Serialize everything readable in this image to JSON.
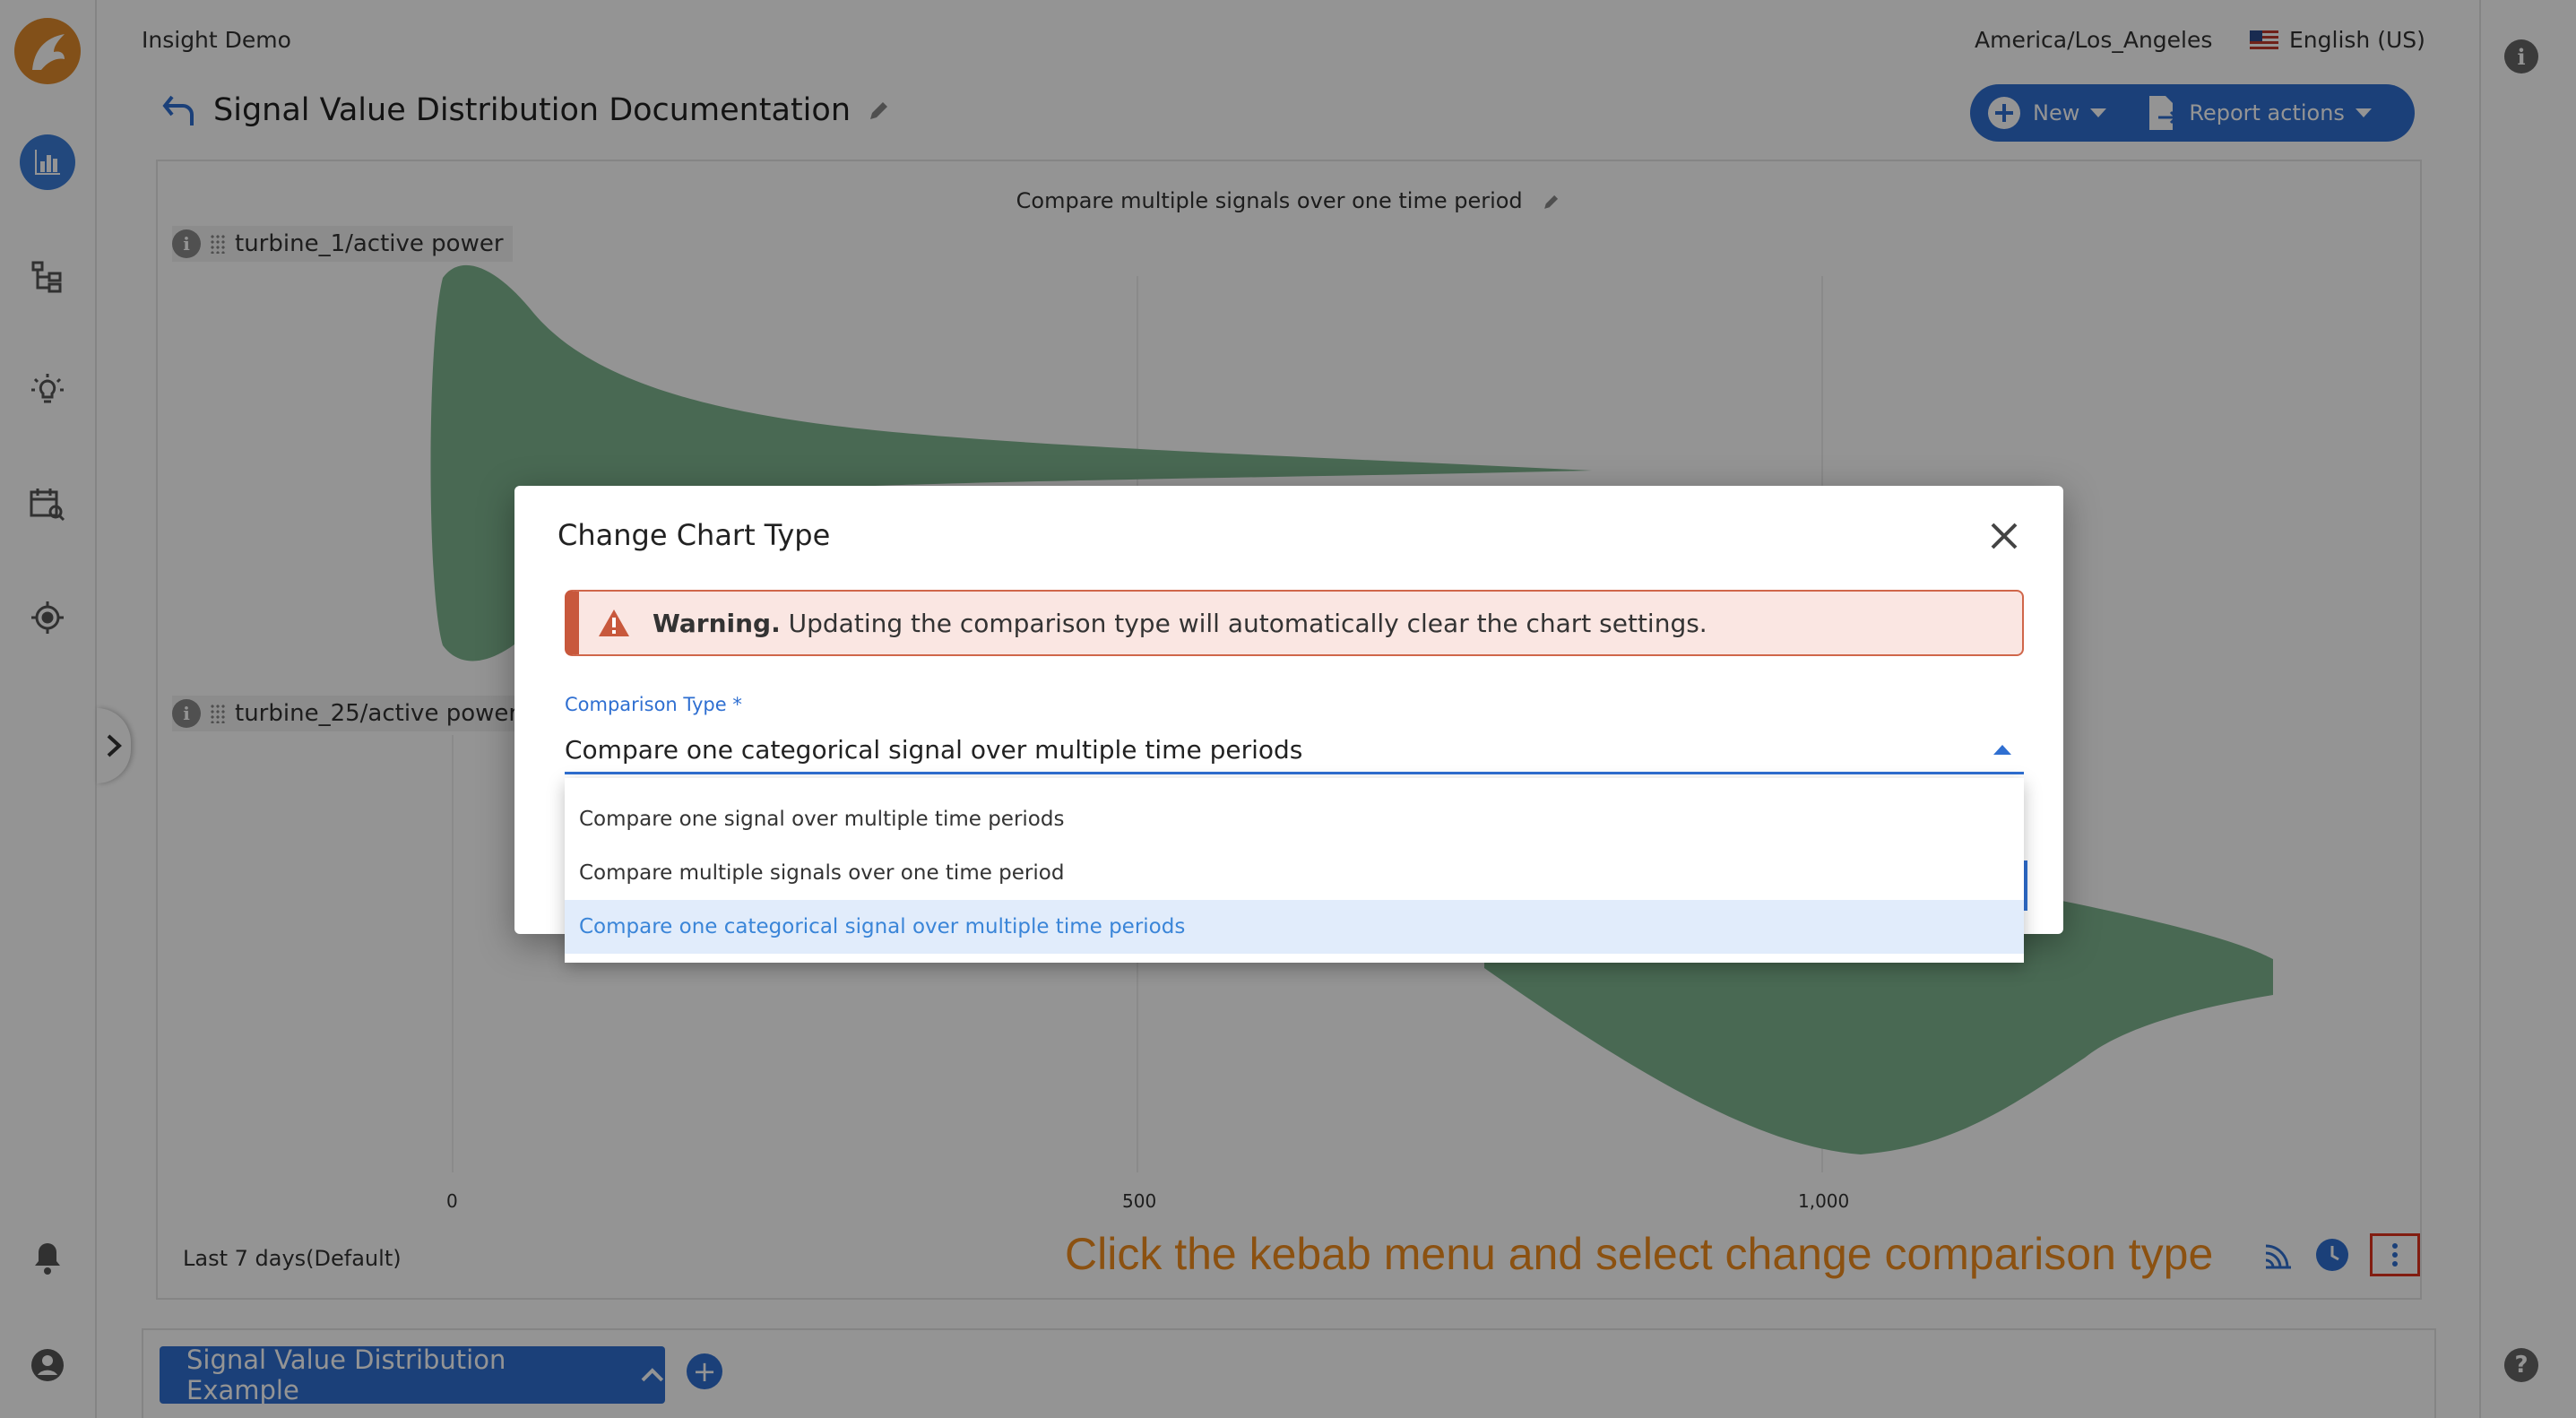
{
  "header": {
    "app_name": "Insight Demo",
    "timezone": "America/Los_Angeles",
    "language": "English (US)",
    "page_title": "Signal Value Distribution Documentation",
    "new_label": "New",
    "report_actions_label": "Report actions"
  },
  "nav": {
    "icons": [
      "analytics-icon",
      "hierarchy-icon",
      "lightbulb-icon",
      "calendar-search-icon",
      "target-icon",
      "bell-icon",
      "account-icon"
    ]
  },
  "chart": {
    "title": "Compare multiple signals over one time period",
    "signals": [
      "turbine_1/active power",
      "turbine_25/active power s"
    ],
    "x_ticks": [
      "0",
      "500",
      "1,000"
    ],
    "range_label": "Last 7 days(Default)"
  },
  "instruction": "Click the kebab menu and select change comparison type",
  "tabs": {
    "active": "Signal Value Distribution Example",
    "add_label": "+"
  },
  "dialog": {
    "title": "Change Chart Type",
    "warning_bold": "Warning.",
    "warning_text": "Updating the comparison type will automatically clear the chart settings.",
    "field_label": "Comparison Type *",
    "field_value": "Compare one categorical signal over multiple time periods",
    "options": [
      "Compare one signal over multiple time periods",
      "Compare multiple signals over one time period",
      "Compare one categorical signal over multiple time periods"
    ],
    "selected_index": 2
  },
  "colors": {
    "accent": "#2f6fd1",
    "violin": "#7fb58f",
    "instruction": "#f08c1e",
    "highlight": "#e0331e"
  }
}
